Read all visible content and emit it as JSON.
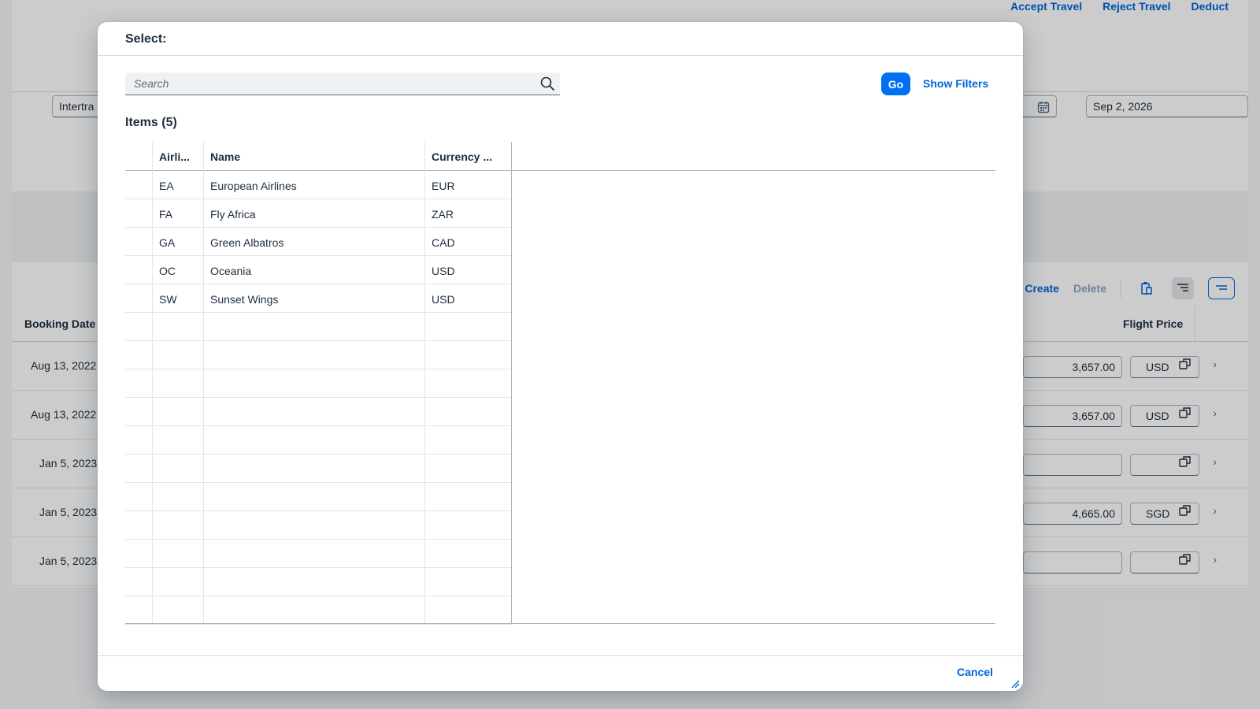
{
  "background": {
    "top_actions": [
      "Accept Travel",
      "Reject Travel",
      "Deduct"
    ],
    "filter_left_value": "Intertra",
    "filter_date_value": "Sep 2, 2026",
    "toolbar": {
      "create": "Create",
      "delete": "Delete"
    },
    "columns": {
      "booking_date": "Booking Date",
      "flight_price": "Flight Price"
    },
    "rows": [
      {
        "date": "Aug 13, 2022",
        "price": "3,657.00",
        "currency": "USD"
      },
      {
        "date": "Aug 13, 2022",
        "price": "3,657.00",
        "currency": "USD"
      },
      {
        "date": "Jan 5, 2023",
        "price": "",
        "currency": ""
      },
      {
        "date": "Jan 5, 2023",
        "price": "4,665.00",
        "currency": "SGD"
      },
      {
        "date": "Jan 5, 2023",
        "price": "",
        "currency": ""
      }
    ],
    "icons": [
      "calendar-icon",
      "clipboard-icon",
      "sort-icon",
      "group-icon",
      "value-help-icon",
      "chevron-right-icon"
    ]
  },
  "dialog": {
    "title": "Select:",
    "search": {
      "placeholder": "Search",
      "value": ""
    },
    "go_label": "Go",
    "show_filters_label": "Show Filters",
    "items_title": "Items (5)",
    "columns": [
      "Airli...",
      "Name",
      "Currency ..."
    ],
    "rows": [
      {
        "airline": "EA",
        "name": "European Airlines",
        "currency": "EUR"
      },
      {
        "airline": "FA",
        "name": "Fly Africa",
        "currency": "ZAR"
      },
      {
        "airline": "GA",
        "name": "Green Albatros",
        "currency": "CAD"
      },
      {
        "airline": "OC",
        "name": "Oceania",
        "currency": "USD"
      },
      {
        "airline": "SW",
        "name": "Sunset Wings",
        "currency": "USD"
      }
    ],
    "cancel_label": "Cancel"
  },
  "colors": {
    "accent": "#0070f2",
    "link": "#0064d9",
    "text": "#1d2d3e",
    "overlay": "rgba(0,0,0,0.2)"
  }
}
